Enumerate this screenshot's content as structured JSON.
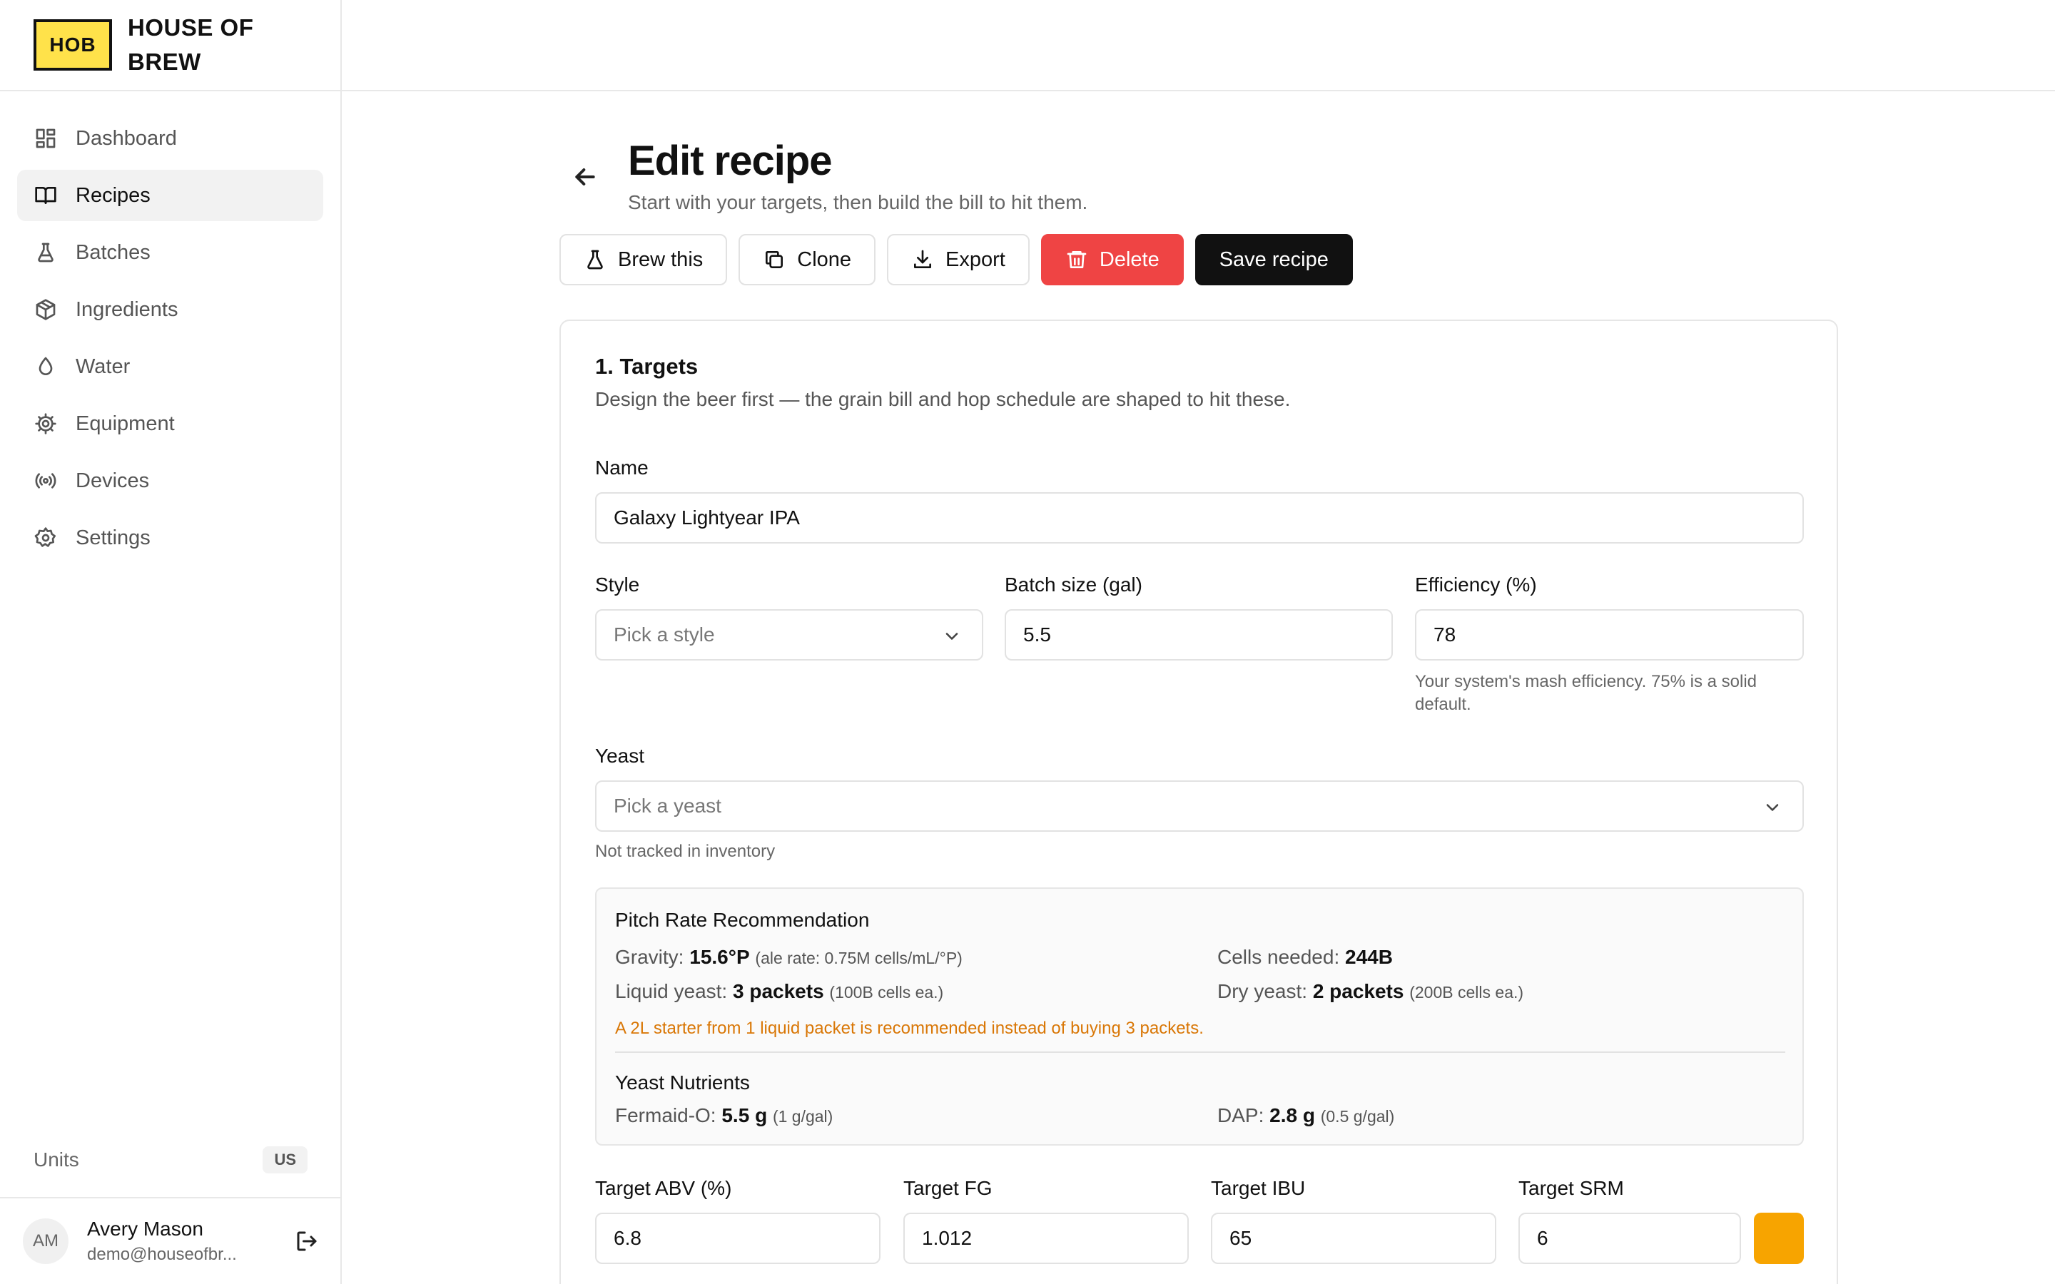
{
  "brand": {
    "logo_text": "HOB",
    "name": "HOUSE OF BREW"
  },
  "nav": {
    "items": [
      {
        "label": "Dashboard",
        "icon": "dashboard-icon",
        "active": false
      },
      {
        "label": "Recipes",
        "icon": "book-icon",
        "active": true
      },
      {
        "label": "Batches",
        "icon": "flask-icon",
        "active": false
      },
      {
        "label": "Ingredients",
        "icon": "package-icon",
        "active": false
      },
      {
        "label": "Water",
        "icon": "droplet-icon",
        "active": false
      },
      {
        "label": "Equipment",
        "icon": "cog-icon",
        "active": false
      },
      {
        "label": "Devices",
        "icon": "radio-icon",
        "active": false
      },
      {
        "label": "Settings",
        "icon": "gear-icon",
        "active": false
      }
    ]
  },
  "units": {
    "label": "Units",
    "value": "US"
  },
  "user": {
    "initials": "AM",
    "name": "Avery Mason",
    "email": "demo@houseofbr..."
  },
  "page": {
    "title": "Edit recipe",
    "subtitle": "Start with your targets, then build the bill to hit them."
  },
  "actions": {
    "brew": "Brew this",
    "clone": "Clone",
    "export": "Export",
    "delete": "Delete",
    "save": "Save recipe"
  },
  "targets": {
    "title": "1. Targets",
    "subtitle": "Design the beer first — the grain bill and hop schedule are shaped to hit these.",
    "name_label": "Name",
    "name_value": "Galaxy Lightyear IPA",
    "style_label": "Style",
    "style_placeholder": "Pick a style",
    "batch_label": "Batch size (gal)",
    "batch_value": "5.5",
    "eff_label": "Efficiency (%)",
    "eff_value": "78",
    "eff_help": "Your system's mash efficiency. 75% is a solid default.",
    "yeast_label": "Yeast",
    "yeast_placeholder": "Pick a yeast",
    "yeast_help": "Not tracked in inventory"
  },
  "pitch": {
    "title": "Pitch Rate Recommendation",
    "gravity_label": "Gravity:",
    "gravity_value": "15.6°P",
    "gravity_note": "(ale rate: 0.75M cells/mL/°P)",
    "cells_label": "Cells needed:",
    "cells_value": "244B",
    "liquid_label": "Liquid yeast:",
    "liquid_value": "3 packets",
    "liquid_note": "(100B cells ea.)",
    "dry_label": "Dry yeast:",
    "dry_value": "2 packets",
    "dry_note": "(200B cells ea.)",
    "warning": "A 2L starter from 1 liquid packet is recommended instead of buying 3 packets.",
    "nutrients_title": "Yeast Nutrients",
    "fermaid_label": "Fermaid-O:",
    "fermaid_value": "5.5 g",
    "fermaid_note": "(1 g/gal)",
    "dap_label": "DAP:",
    "dap_value": "2.8 g",
    "dap_note": "(0.5 g/gal)"
  },
  "target_values": {
    "abv_label": "Target ABV (%)",
    "abv_value": "6.8",
    "fg_label": "Target FG",
    "fg_value": "1.012",
    "ibu_label": "Target IBU",
    "ibu_value": "65",
    "srm_label": "Target SRM",
    "srm_value": "6",
    "srm_color": "#f7a400"
  },
  "colors": {
    "danger": "#ef4444",
    "primary": "#111111",
    "brand": "#ffe24a",
    "warning": "#d97706"
  }
}
